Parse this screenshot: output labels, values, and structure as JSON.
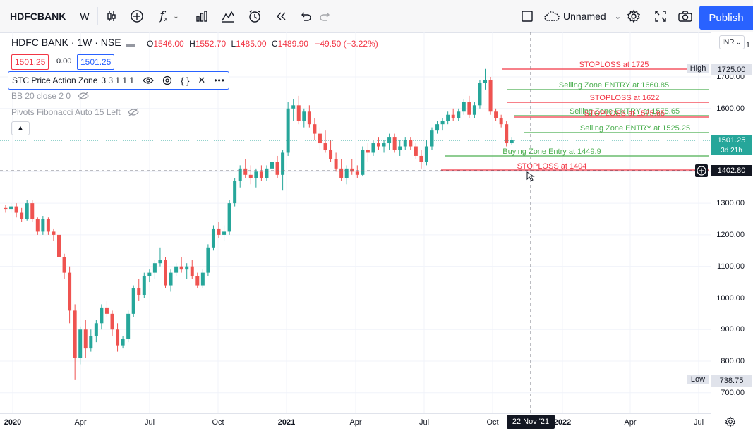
{
  "toolbar": {
    "symbol": "HDFCBANK",
    "interval": "W",
    "layout_name": "Unnamed",
    "publish_label": "Publish"
  },
  "legend": {
    "title": "HDFC BANK · 1W · NSE",
    "ohlc": {
      "o_label": "O",
      "o": "1546.00",
      "h_label": "H",
      "h": "1552.70",
      "l_label": "L",
      "l": "1485.00",
      "c_label": "C",
      "c": "1489.90",
      "change": "−49.50 (−3.22%)"
    },
    "sell_price": "1501.25",
    "spread": "0.00",
    "buy_price": "1501.25"
  },
  "indicators": [
    {
      "name": "STC Price Action Zone",
      "params": "3 3 1 1 1"
    },
    {
      "name": "BB",
      "params": "20 close 2 0"
    },
    {
      "name": "Pivots Fibonacci",
      "params": "Auto 15 Left"
    }
  ],
  "colors": {
    "up": "#26a69a",
    "down": "#ef5350",
    "accent": "#2962ff",
    "sell_line": "#4caf50",
    "stop_line": "#f23645"
  },
  "currency": "INR",
  "price_axis": {
    "ticks": [
      "1700.00",
      "1600.00",
      "1300.00",
      "1200.00",
      "1100.00",
      "1000.00",
      "900.00",
      "800.00",
      "700.00"
    ],
    "top_tick": "1",
    "high_label": "High",
    "high_value": "1725.00",
    "low_label": "Low",
    "low_value": "738.75",
    "last_price": "1501.25",
    "countdown": "3d 21h",
    "crosshair_price": "1402.80"
  },
  "time_axis": {
    "ticks": [
      "2020",
      "Apr",
      "Jul",
      "Oct",
      "2021",
      "Apr",
      "Jul",
      "Oct",
      "2022",
      "Apr",
      "Jul"
    ],
    "cursor_date": "22 Nov '21"
  },
  "zones": [
    {
      "label": "STOPLOSS at 1725",
      "type": "stop"
    },
    {
      "label": "Selling Zone ENTRY at 1660.85",
      "type": "sell"
    },
    {
      "label": "STOPLOSS at 1622",
      "type": "stop"
    },
    {
      "label": "Selling Zone ENTRY at 1575.65",
      "type": "sell"
    },
    {
      "label": "STOPLOSS at 1575.65",
      "type": "stop"
    },
    {
      "label": "Selling Zone ENTRY at 1525.25",
      "type": "sell"
    },
    {
      "label": "Buying Zone Entry at 1449.9",
      "type": "buy"
    },
    {
      "label": "STOPLOSS at 1404",
      "type": "stop"
    }
  ],
  "chart_data": {
    "type": "candlestick",
    "interval": "1W",
    "ylim": [
      680,
      1760
    ],
    "candles": [
      [
        1285,
        1295,
        1270,
        1280
      ],
      [
        1280,
        1300,
        1270,
        1290
      ],
      [
        1290,
        1300,
        1255,
        1270
      ],
      [
        1270,
        1285,
        1240,
        1250
      ],
      [
        1250,
        1310,
        1245,
        1300
      ],
      [
        1300,
        1310,
        1240,
        1250
      ],
      [
        1250,
        1255,
        1200,
        1210
      ],
      [
        1210,
        1260,
        1200,
        1250
      ],
      [
        1250,
        1255,
        1200,
        1210
      ],
      [
        1210,
        1220,
        1180,
        1200
      ],
      [
        1200,
        1210,
        1120,
        1130
      ],
      [
        1130,
        1140,
        1060,
        1080
      ],
      [
        1080,
        1100,
        920,
        960
      ],
      [
        960,
        980,
        740,
        810
      ],
      [
        810,
        910,
        790,
        900
      ],
      [
        900,
        930,
        810,
        840
      ],
      [
        840,
        900,
        830,
        880
      ],
      [
        880,
        930,
        860,
        920
      ],
      [
        920,
        980,
        900,
        970
      ],
      [
        970,
        990,
        940,
        950
      ],
      [
        950,
        960,
        880,
        900
      ],
      [
        900,
        920,
        830,
        850
      ],
      [
        850,
        880,
        840,
        870
      ],
      [
        870,
        960,
        860,
        950
      ],
      [
        950,
        1040,
        940,
        1030
      ],
      [
        1030,
        1060,
        990,
        1010
      ],
      [
        1010,
        1080,
        1000,
        1070
      ],
      [
        1070,
        1090,
        1050,
        1080
      ],
      [
        1080,
        1120,
        1060,
        1110
      ],
      [
        1110,
        1160,
        1100,
        1120
      ],
      [
        1120,
        1130,
        1030,
        1040
      ],
      [
        1040,
        1090,
        1020,
        1080
      ],
      [
        1080,
        1110,
        1070,
        1100
      ],
      [
        1100,
        1130,
        1080,
        1090
      ],
      [
        1090,
        1110,
        1060,
        1100
      ],
      [
        1100,
        1120,
        1060,
        1070
      ],
      [
        1070,
        1080,
        1030,
        1040
      ],
      [
        1040,
        1090,
        1030,
        1080
      ],
      [
        1080,
        1170,
        1070,
        1160
      ],
      [
        1160,
        1230,
        1150,
        1220
      ],
      [
        1220,
        1240,
        1190,
        1200
      ],
      [
        1200,
        1230,
        1180,
        1210
      ],
      [
        1210,
        1310,
        1200,
        1300
      ],
      [
        1300,
        1380,
        1290,
        1370
      ],
      [
        1370,
        1420,
        1350,
        1410
      ],
      [
        1410,
        1440,
        1380,
        1390
      ],
      [
        1390,
        1420,
        1360,
        1380
      ],
      [
        1380,
        1410,
        1350,
        1400
      ],
      [
        1400,
        1420,
        1370,
        1380
      ],
      [
        1380,
        1420,
        1370,
        1410
      ],
      [
        1410,
        1440,
        1400,
        1430
      ],
      [
        1430,
        1450,
        1380,
        1390
      ],
      [
        1390,
        1470,
        1340,
        1460
      ],
      [
        1460,
        1620,
        1450,
        1600
      ],
      [
        1600,
        1630,
        1560,
        1610
      ],
      [
        1610,
        1640,
        1550,
        1560
      ],
      [
        1560,
        1600,
        1540,
        1590
      ],
      [
        1590,
        1610,
        1540,
        1550
      ],
      [
        1550,
        1570,
        1500,
        1520
      ],
      [
        1520,
        1540,
        1470,
        1490
      ],
      [
        1490,
        1530,
        1460,
        1470
      ],
      [
        1470,
        1500,
        1430,
        1440
      ],
      [
        1440,
        1460,
        1400,
        1410
      ],
      [
        1410,
        1440,
        1370,
        1380
      ],
      [
        1380,
        1420,
        1360,
        1410
      ],
      [
        1410,
        1440,
        1390,
        1400
      ],
      [
        1400,
        1420,
        1380,
        1390
      ],
      [
        1390,
        1480,
        1385,
        1470
      ],
      [
        1470,
        1490,
        1430,
        1460
      ],
      [
        1460,
        1500,
        1450,
        1490
      ],
      [
        1490,
        1510,
        1470,
        1480
      ],
      [
        1480,
        1500,
        1460,
        1490
      ],
      [
        1490,
        1520,
        1470,
        1510
      ],
      [
        1510,
        1520,
        1460,
        1470
      ],
      [
        1470,
        1500,
        1450,
        1480
      ],
      [
        1480,
        1510,
        1470,
        1500
      ],
      [
        1500,
        1510,
        1470,
        1480
      ],
      [
        1480,
        1490,
        1440,
        1450
      ],
      [
        1450,
        1470,
        1410,
        1430
      ],
      [
        1430,
        1500,
        1420,
        1480
      ],
      [
        1480,
        1540,
        1470,
        1530
      ],
      [
        1530,
        1560,
        1520,
        1550
      ],
      [
        1550,
        1570,
        1530,
        1560
      ],
      [
        1560,
        1590,
        1550,
        1580
      ],
      [
        1580,
        1600,
        1560,
        1570
      ],
      [
        1570,
        1600,
        1560,
        1590
      ],
      [
        1590,
        1630,
        1580,
        1620
      ],
      [
        1620,
        1640,
        1570,
        1580
      ],
      [
        1580,
        1620,
        1570,
        1610
      ],
      [
        1610,
        1690,
        1600,
        1680
      ],
      [
        1680,
        1725,
        1660,
        1690
      ],
      [
        1690,
        1700,
        1580,
        1590
      ],
      [
        1590,
        1600,
        1560,
        1570
      ],
      [
        1570,
        1580,
        1540,
        1550
      ],
      [
        1550,
        1560,
        1480,
        1490
      ],
      [
        1490,
        1510,
        1485,
        1501
      ]
    ]
  }
}
